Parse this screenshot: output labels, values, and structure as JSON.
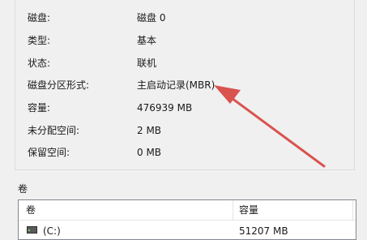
{
  "properties": [
    {
      "label": "磁盘:",
      "value": "磁盘 0"
    },
    {
      "label": "类型:",
      "value": "基本"
    },
    {
      "label": "状态:",
      "value": "联机"
    },
    {
      "label": "磁盘分区形式:",
      "value": "主启动记录(MBR)"
    },
    {
      "label": "容量:",
      "value": "476939 MB"
    },
    {
      "label": "未分配空间:",
      "value": "2 MB"
    },
    {
      "label": "保留空间:",
      "value": "0 MB"
    }
  ],
  "volumes": {
    "section_label": "卷",
    "columns": {
      "volume": "卷",
      "capacity": "容量"
    },
    "rows": [
      {
        "name": "(C:)",
        "capacity": "51207 MB",
        "icon": "drive-icon"
      }
    ]
  },
  "annotation": {
    "icon": "red-arrow-icon",
    "color": "#d9534f"
  }
}
